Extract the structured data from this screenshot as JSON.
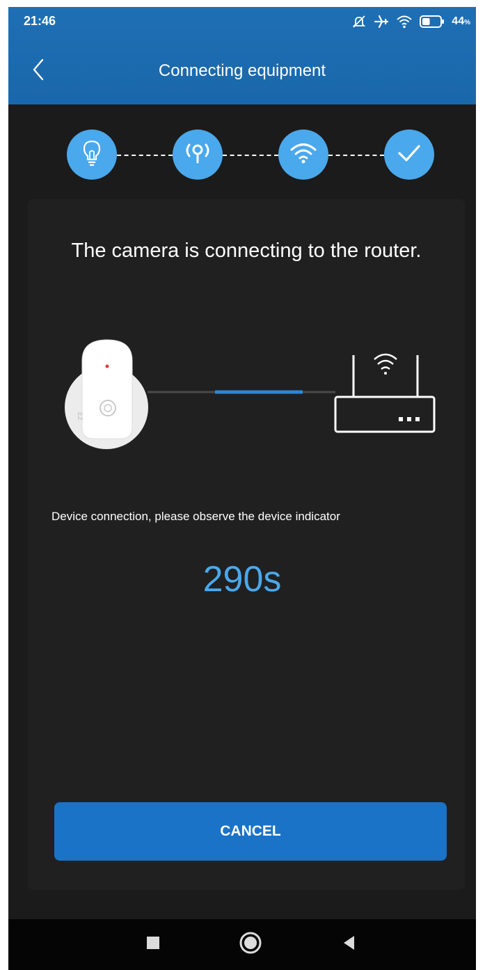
{
  "status_bar": {
    "time": "21:46",
    "battery_percent": "44",
    "battery_level": 0.44,
    "icons": [
      "mute-bell-icon",
      "airplane-icon",
      "wifi-icon",
      "battery-icon"
    ]
  },
  "header": {
    "title": "Connecting equipment",
    "back_icon": "chevron-left-icon"
  },
  "stepper": {
    "steps": [
      {
        "icon": "lightbulb-icon",
        "state": "done"
      },
      {
        "icon": "hotspot-icon",
        "state": "done"
      },
      {
        "icon": "wifi-icon",
        "state": "done"
      },
      {
        "icon": "check-icon",
        "state": "current"
      }
    ]
  },
  "main": {
    "title": "The camera is connecting to the router.",
    "device_icon": "camera-device-icon",
    "router_icon": "router-icon",
    "hint": "Device connection, please observe the device indicator",
    "countdown": "290s"
  },
  "actions": {
    "cancel_label": "CANCEL"
  },
  "navbar": {
    "items": [
      "recents-square-icon",
      "home-circle-icon",
      "back-triangle-icon"
    ]
  },
  "colors": {
    "accent": "#4aa8ec",
    "header": "#1f6fb4",
    "button": "#1a73c6",
    "background": "#1b1b1b",
    "card": "#202020"
  }
}
